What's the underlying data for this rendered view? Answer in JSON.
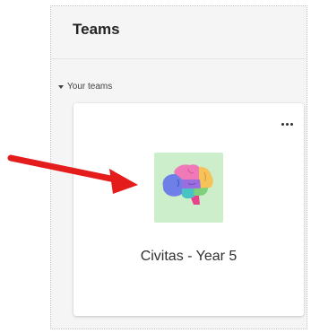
{
  "header": {
    "title": "Teams"
  },
  "section": {
    "label": "Your teams"
  },
  "team_card": {
    "name": "Civitas - Year 5",
    "avatar_icon": "brain-icon",
    "avatar_bg": "#cdeecb",
    "more_icon": "more-options-icon"
  },
  "annotation": {
    "icon": "red-arrow-icon",
    "color": "#e51c1c"
  }
}
